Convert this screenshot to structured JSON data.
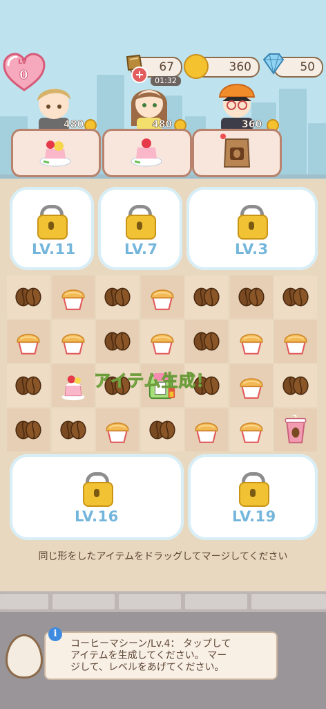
{
  "header": {
    "level_label": "LV",
    "level_value": "0",
    "energy": "67",
    "energy_timer": "01:32",
    "coins": "360",
    "gems": "50"
  },
  "customers": [
    {
      "name": "blond-man",
      "reward": "480",
      "order": "strawberry-cake-plate-icon"
    },
    {
      "name": "brown-hair-woman",
      "reward": "480",
      "order": "strawberry-cake-plate-icon"
    },
    {
      "name": "orange-beanie-man",
      "reward": "360",
      "order": "coffee-bag-icon"
    }
  ],
  "board": {
    "locked_areas": [
      {
        "label": "LV.11"
      },
      {
        "label": "LV.7"
      },
      {
        "label": "LV.3"
      },
      {
        "label": "LV.16"
      },
      {
        "label": "LV.19"
      }
    ],
    "generate_message": "アイテム生成！",
    "items": [
      [
        "coffee-bean",
        "muffin",
        "coffee-bean",
        "muffin",
        "coffee-bean",
        "coffee-bean",
        "coffee-bean"
      ],
      [
        "muffin",
        "muffin",
        "coffee-bean",
        "muffin",
        "coffee-bean",
        "muffin",
        "muffin"
      ],
      [
        "coffee-bean",
        "strawberry-cake",
        "coffee-bean",
        "coffee-machine",
        "coffee-bean",
        "muffin",
        "coffee-bean"
      ],
      [
        "coffee-bean",
        "coffee-bean",
        "muffin",
        "coffee-bean",
        "muffin",
        "muffin",
        "coffee-cup"
      ]
    ]
  },
  "hint_text": "同じ形をしたアイテムをドラッグしてマージしてください",
  "tip": {
    "line1": "コーヒーマシーン/Lv.4：  タップして",
    "line2": "アイテムを生成してください。 マー",
    "line3": "ジして、レベルをあげてください。"
  },
  "colors": {
    "sky": "#bfe3ee",
    "board_light": "#efdcc5",
    "board_dark": "#e6cfb4",
    "lock_text": "#74b6db",
    "accent_text": "#5d4634"
  }
}
